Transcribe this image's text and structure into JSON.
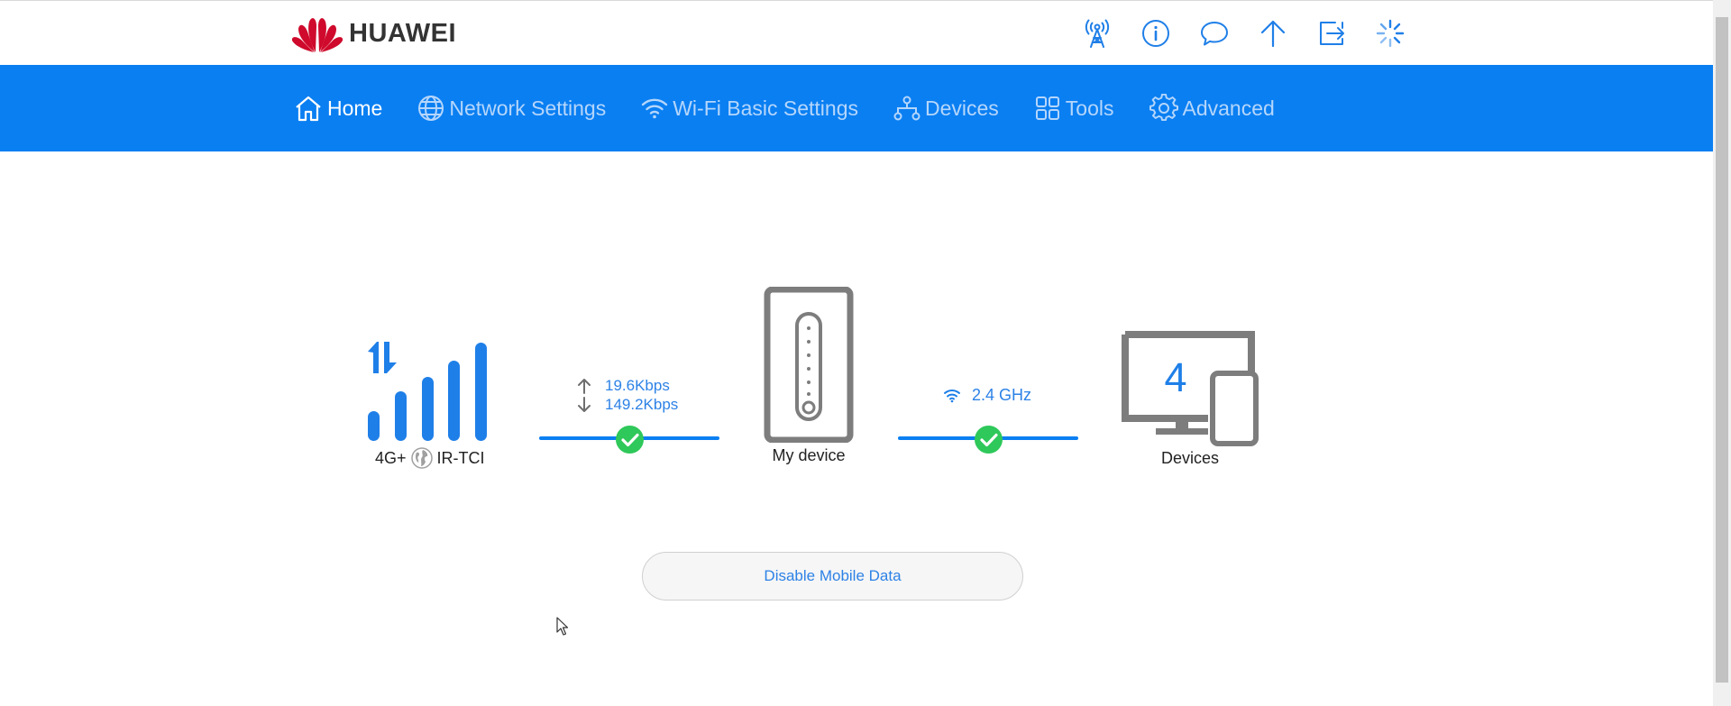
{
  "brand": {
    "name": "HUAWEI",
    "logo_color": "#cf0a2c"
  },
  "header_icons": [
    {
      "icon": "antenna-icon"
    },
    {
      "icon": "info-icon"
    },
    {
      "icon": "message-icon"
    },
    {
      "icon": "upload-arrow-icon"
    },
    {
      "icon": "logout-icon"
    },
    {
      "icon": "loading-spinner-icon"
    }
  ],
  "nav": {
    "items": [
      {
        "label": "Home",
        "icon": "home-icon",
        "active": true
      },
      {
        "label": "Network Settings",
        "icon": "globe-icon",
        "active": false
      },
      {
        "label": "Wi-Fi Basic Settings",
        "icon": "wifi-icon",
        "active": false
      },
      {
        "label": "Devices",
        "icon": "network-tree-icon",
        "active": false
      },
      {
        "label": "Tools",
        "icon": "tools-grid-icon",
        "active": false
      },
      {
        "label": "Advanced",
        "icon": "gear-icon",
        "active": false
      }
    ]
  },
  "status": {
    "network_type": "4G+",
    "operator": "IR-TCI",
    "upload_rate": "19.6Kbps",
    "download_rate": "149.2Kbps",
    "router_label": "My device",
    "wifi_band": "2.4 GHz",
    "device_count": "4",
    "devices_label": "Devices",
    "wan_connected": true,
    "wifi_connected": true
  },
  "actions": {
    "disable_mobile_data": "Disable Mobile Data"
  },
  "colors": {
    "accent": "#0a7ff2",
    "nav_text_inactive": "#b5d6fb",
    "link_text": "#2d82e6",
    "success": "#2fc85a",
    "device_gray": "#7d7d7d"
  }
}
